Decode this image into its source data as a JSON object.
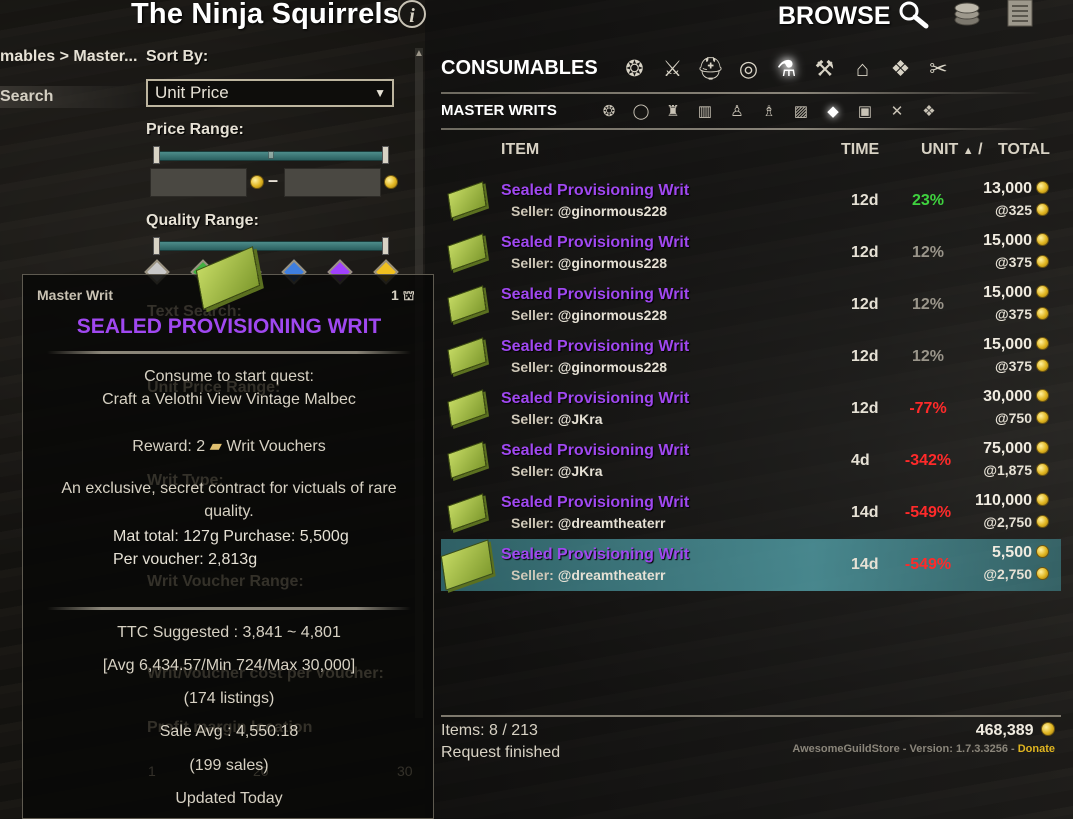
{
  "header": {
    "guild_name": "The Ninja Squirrels",
    "info_icon": "info-icon",
    "browse_label": "BROWSE",
    "top_icons": [
      "search-icon",
      "coins-icon",
      "list-icon"
    ]
  },
  "filters": {
    "breadcrumb": "mables > Master...",
    "search_label": "Search",
    "sort_by_label": "Sort By:",
    "sort_value": "Unit Price",
    "price_range_label": "Price Range:",
    "price_dash": "–",
    "quality_range_label": "Quality Range:",
    "quality_gems": [
      "#c8c8c8",
      "#40b040",
      "#3f7fe0",
      "#a040ff",
      "#f0c020"
    ],
    "hidden_labels": [
      "Text Search:",
      "Unit Price Range:",
      "Writ Type:",
      "Writ Voucher Range:",
      "Writ/Voucher cost per voucher:",
      "Profit margin location"
    ],
    "hidden_scale_min": "1",
    "hidden_scale_mid": "20",
    "hidden_scale_max": "30"
  },
  "category": {
    "title": "CONSUMABLES",
    "icons": [
      "all-icon",
      "weapons-icon",
      "armor-icon",
      "jewelry-icon",
      "consumables-icon",
      "materials-icon",
      "furnishing-icon",
      "misc-icon",
      "crafting-icon"
    ],
    "active_index": 4,
    "subtitle": "MASTER WRITS",
    "sub_icons": [
      "all-writs-icon",
      "jewelry-writ-icon",
      "blacksmith-writ-icon",
      "clothier-writ-icon",
      "enchanter-writ-icon",
      "alchemy-writ-icon",
      "provisioning-writ-icon",
      "woodworking-writ-icon",
      "bank-writ-icon",
      "tools-writ-icon",
      "misc-writ-icon"
    ],
    "sub_active_index": 7
  },
  "columns": {
    "item": "ITEM",
    "time": "TIME",
    "unit": "UNIT",
    "sort_arrow": "▲",
    "sep": "/",
    "total": "TOTAL"
  },
  "colors": {
    "item_name": "#a048f0",
    "unit_green": "#3fd23f",
    "unit_gray": "#9a958a",
    "unit_red": "#ff2a2a",
    "donate": "#e0b520"
  },
  "listings": [
    {
      "name": "Sealed Provisioning Writ",
      "seller_label": "Seller:",
      "seller": "@ginormous228",
      "time": "12d",
      "unit": "23%",
      "unit_color": "#3fd23f",
      "total": "13,000",
      "per": "@325"
    },
    {
      "name": "Sealed Provisioning Writ",
      "seller_label": "Seller:",
      "seller": "@ginormous228",
      "time": "12d",
      "unit": "12%",
      "unit_color": "#9a958a",
      "total": "15,000",
      "per": "@375"
    },
    {
      "name": "Sealed Provisioning Writ",
      "seller_label": "Seller:",
      "seller": "@ginormous228",
      "time": "12d",
      "unit": "12%",
      "unit_color": "#9a958a",
      "total": "15,000",
      "per": "@375"
    },
    {
      "name": "Sealed Provisioning Writ",
      "seller_label": "Seller:",
      "seller": "@ginormous228",
      "time": "12d",
      "unit": "12%",
      "unit_color": "#9a958a",
      "total": "15,000",
      "per": "@375"
    },
    {
      "name": "Sealed Provisioning Writ",
      "seller_label": "Seller:",
      "seller": "@JKra",
      "time": "12d",
      "unit": "-77%",
      "unit_color": "#ff2a2a",
      "total": "30,000",
      "per": "@750"
    },
    {
      "name": "Sealed Provisioning Writ",
      "seller_label": "Seller:",
      "seller": "@JKra",
      "time": "4d",
      "unit": "-342%",
      "unit_color": "#ff2a2a",
      "total": "75,000",
      "per": "@1,875"
    },
    {
      "name": "Sealed Provisioning Writ",
      "seller_label": "Seller:",
      "seller": "@dreamtheaterr",
      "time": "14d",
      "unit": "-549%",
      "unit_color": "#ff2a2a",
      "total": "110,000",
      "per": "@2,750"
    },
    {
      "name": "Sealed Provisioning Writ",
      "seller_label": "Seller:",
      "seller": "@dreamtheaterr",
      "time": "14d",
      "unit": "-549%",
      "unit_color": "#ff2a2a",
      "total": "5,500",
      "per": "@2,750",
      "selected": true
    }
  ],
  "footer": {
    "items_count": "Items: 8 / 213",
    "status": "Request finished",
    "gold": "468,389",
    "version": "AwesomeGuildStore - Version: 1.7.3.3256 -",
    "donate": "Donate"
  },
  "tooltip": {
    "type": "Master Writ",
    "count": "1",
    "title": "SEALED PROVISIONING WRIT",
    "consume_line": "Consume to start quest:",
    "quest_line": "Craft a Velothi View Vintage Malbec",
    "reward_prefix": "Reward: 2",
    "reward_suffix": "Writ Vouchers",
    "desc_line1": "An exclusive, secret contract for victuals of rare",
    "desc_line2": "quality.",
    "mat_total": "Mat total: 127g  Purchase: 5,500g",
    "per_voucher": "Per voucher: 2,813g",
    "ttc_suggested": "TTC Suggested : 3,841 ~ 4,801",
    "ttc_avg": "[Avg 6,434.57/Min 724/Max 30,000]",
    "listings": "(174 listings)",
    "sale_avg": "Sale Avg : 4,550.18",
    "sales": "(199 sales)",
    "updated": "Updated Today",
    "title_color": "#a048f0"
  }
}
